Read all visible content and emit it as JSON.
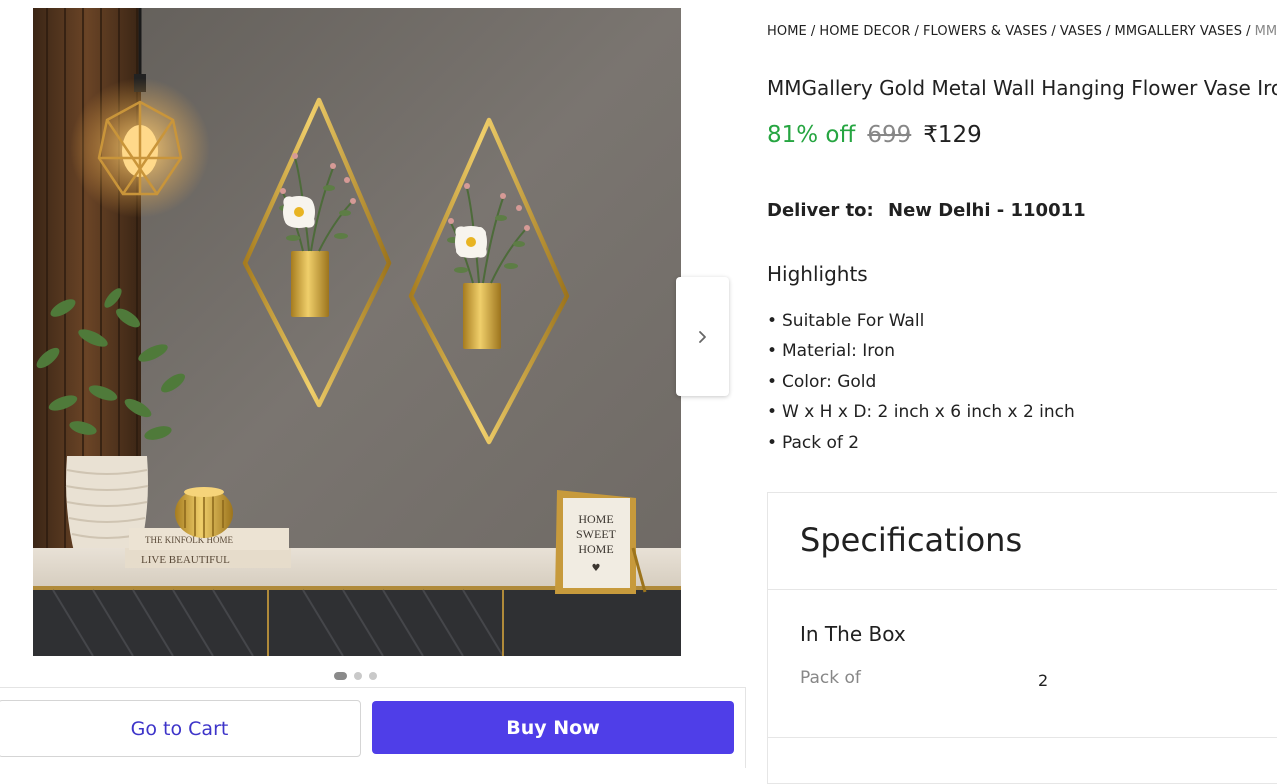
{
  "breadcrumb": {
    "items": [
      "HOME",
      "HOME DECOR",
      "FLOWERS & VASES",
      "VASES",
      "MMGALLERY VASES",
      "MM"
    ],
    "separator": "/"
  },
  "product": {
    "title": "MMGallery Gold Metal Wall Hanging Flower Vase Iron",
    "discount": "81% off",
    "mrp": "699",
    "price": "₹129"
  },
  "delivery": {
    "label": "Deliver to:",
    "location": "New Delhi - 110011"
  },
  "highlights": {
    "title": "Highlights",
    "bullet": "•",
    "items": [
      "Suitable For Wall",
      "Material: Iron",
      "Color: Gold",
      "W x H x D: 2 inch x 6 inch x 2 inch",
      "Pack of 2"
    ]
  },
  "specifications": {
    "title": "Specifications",
    "section_title": "In The Box",
    "rows": [
      {
        "label": "Pack of",
        "value": "2"
      }
    ]
  },
  "image_carousel": {
    "slide_count": 3,
    "active_slide": 1,
    "next_icon": "chevron-right-icon",
    "frame_text": [
      "HOME",
      "SWEET",
      "HOME"
    ],
    "book_text": [
      "THE KINFOLK HOME",
      "LIVE BEAUTIFUL"
    ]
  },
  "actions": {
    "go_to_cart_label": "Go to Cart",
    "buy_now_label": "Buy Now"
  },
  "colors": {
    "discount_green": "#26a541",
    "buy_now_bg": "#4f3ee8",
    "go_to_cart_text": "#3d34c9",
    "muted_text": "#878787"
  }
}
